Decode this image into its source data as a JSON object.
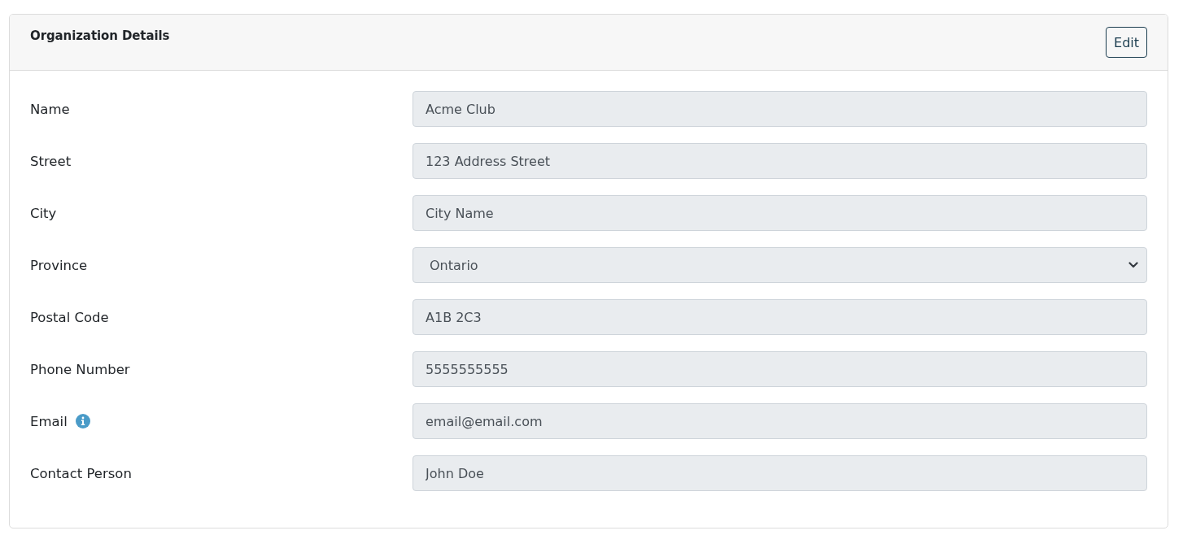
{
  "card": {
    "title": "Organization Details",
    "edit_button": {
      "label": "Edit"
    }
  },
  "fields": [
    {
      "label": "Name",
      "kind": "text",
      "value": "Acme Club",
      "disabled": true,
      "info": false
    },
    {
      "label": "Street",
      "kind": "text",
      "value": "123 Address Street",
      "disabled": true,
      "info": false
    },
    {
      "label": "City",
      "kind": "text",
      "value": "City Name",
      "disabled": true,
      "info": false
    },
    {
      "label": "Province",
      "kind": "select",
      "value": "Ontario",
      "disabled": true,
      "info": false
    },
    {
      "label": "Postal Code",
      "kind": "text",
      "value": "A1B 2C3",
      "disabled": true,
      "info": false
    },
    {
      "label": "Phone Number",
      "kind": "text",
      "value": "5555555555",
      "disabled": true,
      "info": false
    },
    {
      "label": "Email",
      "kind": "text",
      "value": "email@email.com",
      "disabled": true,
      "info": true
    },
    {
      "label": "Contact Person",
      "kind": "text",
      "value": "John Doe",
      "disabled": true,
      "info": false
    }
  ]
}
